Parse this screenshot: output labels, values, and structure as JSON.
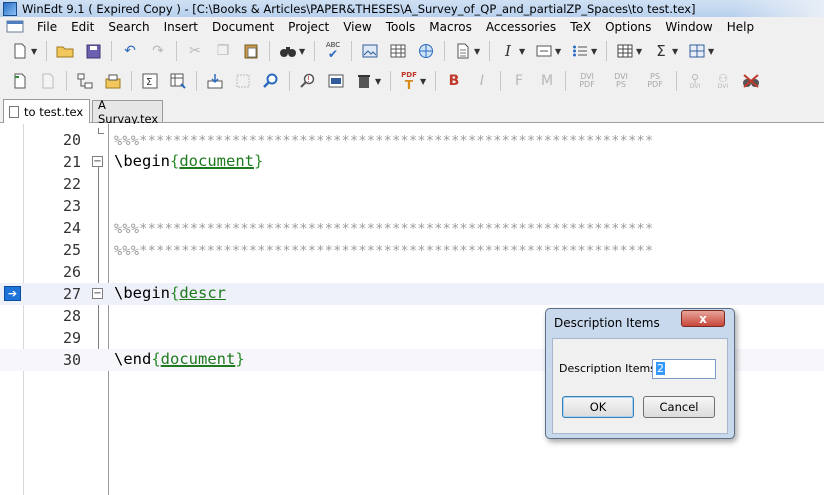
{
  "window": {
    "title": "WinEdt 9.1  ( Expired  Copy )  - [C:\\Books & Articles\\PAPER&THESES\\A_Survey_of_QP_and_partialZP_Spaces\\to test.tex]"
  },
  "menu": [
    "File",
    "Edit",
    "Search",
    "Insert",
    "Document",
    "Project",
    "View",
    "Tools",
    "Macros",
    "Accessories",
    "TeX",
    "Options",
    "Window",
    "Help"
  ],
  "toolbar1": {
    "icons": [
      "new-file-icon",
      "open-folder-icon",
      "save-icon",
      "undo-icon",
      "redo-icon",
      "cut-icon",
      "copy-icon",
      "paste-icon",
      "find-binoculars-icon",
      "spell-check-icon",
      "image-icon",
      "table-icon",
      "web-icon",
      "document-icon",
      "italic-icon",
      "box-icon",
      "list-icon",
      "grid-icon",
      "sigma-icon",
      "matrix-icon"
    ],
    "spell_label": "ABC",
    "italic_label": "I",
    "sigma_label": "Σ"
  },
  "toolbar2": {
    "bold_label": "B",
    "italic_label": "I",
    "f_label": "F",
    "m_label": "M",
    "dvi_pdf": [
      "DVI",
      "PDF"
    ],
    "dvi_ps": [
      "DVI",
      "PS"
    ],
    "ps_pdf": [
      "PS",
      "PDF"
    ],
    "dvi_label": "DVI",
    "pdf_label": "PDF"
  },
  "tabs": [
    {
      "label": "to test.tex",
      "active": true
    },
    {
      "label": "A Survay.tex",
      "active": false
    }
  ],
  "editor": {
    "current_line": 27,
    "lines": [
      {
        "num": "20",
        "text": "%%%*************************************************************"
      },
      {
        "num": "21",
        "kw": "\\begin",
        "open": "{",
        "arg": "document",
        "close": "}"
      },
      {
        "num": "22",
        "text": ""
      },
      {
        "num": "23",
        "text": ""
      },
      {
        "num": "24",
        "text": "%%%*************************************************************"
      },
      {
        "num": "25",
        "text": "%%%*************************************************************"
      },
      {
        "num": "26",
        "text": ""
      },
      {
        "num": "27",
        "kw": "\\begin",
        "open": "{",
        "arg": "descr",
        "close": ""
      },
      {
        "num": "28",
        "text": ""
      },
      {
        "num": "29",
        "text": ""
      },
      {
        "num": "30",
        "kw": "\\end",
        "open": "{",
        "arg": "document",
        "close": "}"
      }
    ]
  },
  "dialog": {
    "title": "Description Items",
    "close_label": "x",
    "field_label": "Description Items:",
    "field_value": "2",
    "ok_label": "OK",
    "cancel_label": "Cancel"
  }
}
